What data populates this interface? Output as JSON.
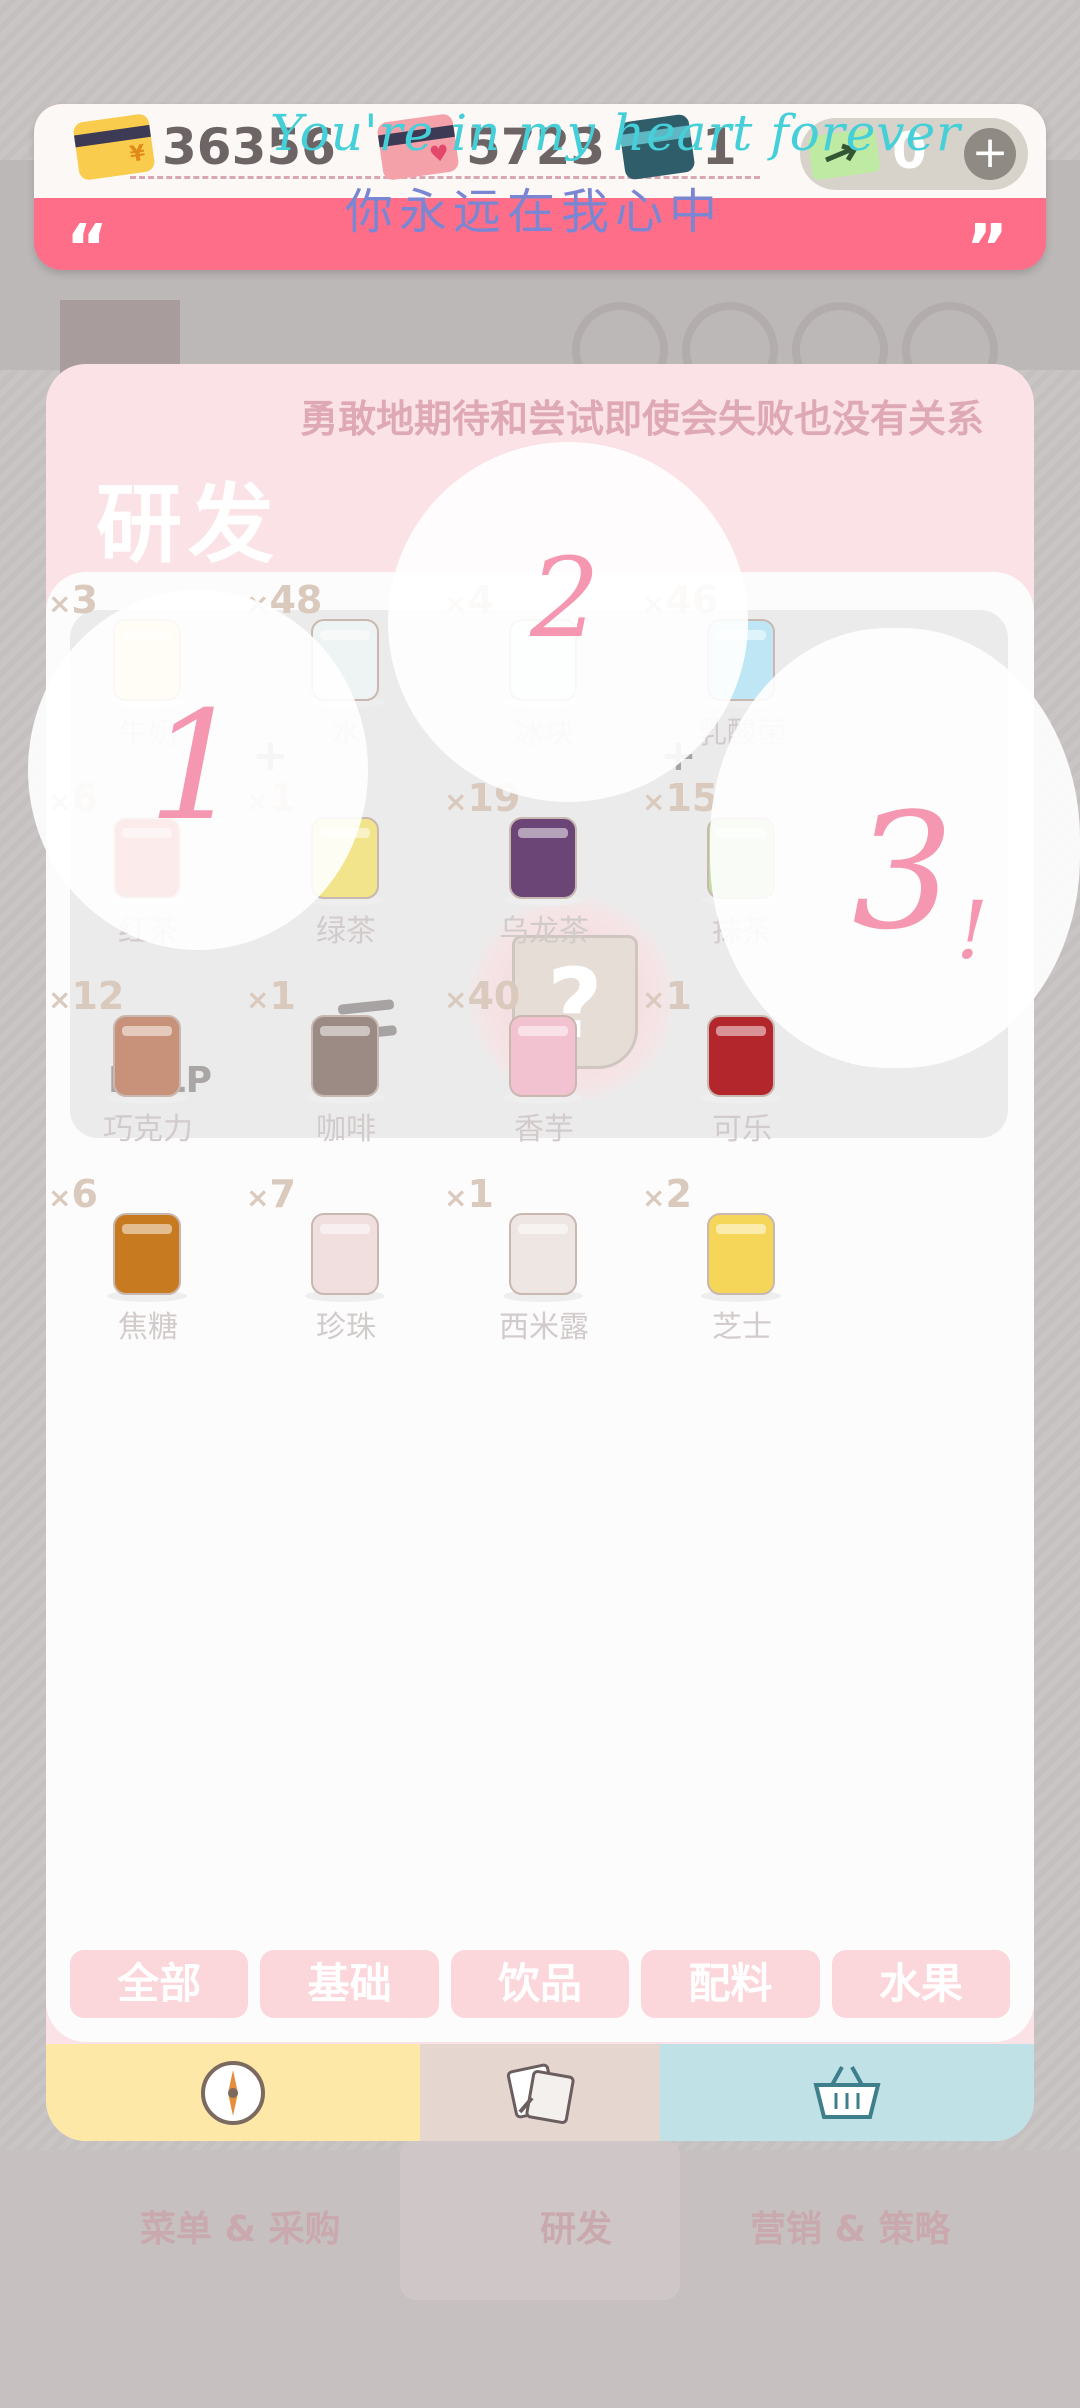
{
  "currency": {
    "coins": "36356",
    "hearts": "5723",
    "tickets": "1",
    "cash": "0",
    "add_label": "+"
  },
  "lyrics": {
    "line1": "You're in my heart forever",
    "line2": "你永远在我心中"
  },
  "quotes": {
    "open": "“",
    "close": "”"
  },
  "panel": {
    "motto": "勇敢地期待和尝试即使会失败也没有关系",
    "title": "研发"
  },
  "craft": {
    "help": "HELP",
    "plus": "+",
    "result": "?",
    "slot1": "1",
    "slot2": "2",
    "slot3": "3",
    "slot3_mark": "!"
  },
  "ingredients": [
    {
      "name": "牛奶",
      "qty": "3",
      "icon": "milk-carton-icon",
      "color": "#f7e7a6"
    },
    {
      "name": "水",
      "qty": "48",
      "icon": "water-glass-icon",
      "color": "#eef3f3"
    },
    {
      "name": "冰块",
      "qty": "4",
      "icon": "ice-bowl-icon",
      "color": "#eaf2f6"
    },
    {
      "name": "乳酸菌",
      "qty": "46",
      "icon": "yogurt-box-icon",
      "color": "#bfe6f5"
    },
    {
      "name": "红茶",
      "qty": "6",
      "icon": "black-tea-tin-icon",
      "color": "#d83b3b"
    },
    {
      "name": "绿茶",
      "qty": "1",
      "icon": "green-tea-tin-icon",
      "color": "#f2e48a"
    },
    {
      "name": "乌龙茶",
      "qty": "19",
      "icon": "oolong-tin-icon",
      "color": "#6b4576"
    },
    {
      "name": "抹茶",
      "qty": "15",
      "icon": "matcha-bag-icon",
      "color": "#bfe0a0"
    },
    {
      "name": "巧克力",
      "qty": "12",
      "icon": "chocolate-bag-icon",
      "color": "#c8927a"
    },
    {
      "name": "咖啡",
      "qty": "1",
      "icon": "coffee-bag-icon",
      "color": "#9c8b84"
    },
    {
      "name": "香芋",
      "qty": "40",
      "icon": "taro-cup-icon",
      "color": "#f3c2d0"
    },
    {
      "name": "可乐",
      "qty": "1",
      "icon": "cola-bottle-icon",
      "color": "#b3262c"
    },
    {
      "name": "焦糖",
      "qty": "6",
      "icon": "caramel-jar-icon",
      "color": "#c77a1f"
    },
    {
      "name": "珍珠",
      "qty": "7",
      "icon": "pearl-cup-icon",
      "color": "#f1dfe0"
    },
    {
      "name": "西米露",
      "qty": "1",
      "icon": "sago-cup-icon",
      "color": "#eee6e2"
    },
    {
      "name": "芝士",
      "qty": "2",
      "icon": "cheese-plate-icon",
      "color": "#f6d659"
    }
  ],
  "filters": [
    "全部",
    "基础",
    "饮品",
    "配料",
    "水果"
  ],
  "nav": {
    "left_icon": "compass-icon",
    "mid_icon": "notes-icon",
    "right_icon": "basket-icon"
  },
  "background_tabs": {
    "left": "菜单 & 采购",
    "mid": "研发",
    "right": "营销 & 策略"
  },
  "colors": {
    "accent": "#ff6e88",
    "panel": "#fbe2e6",
    "nav_yellow": "#fde8a8",
    "nav_beige": "#e6d6d0",
    "nav_teal": "#c0e2e6"
  }
}
